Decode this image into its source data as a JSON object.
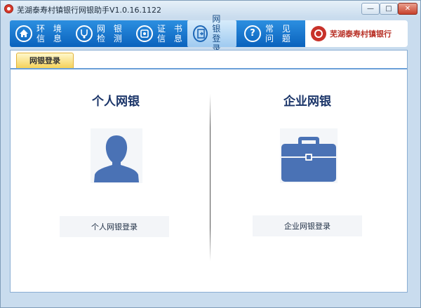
{
  "window": {
    "title": "芜湖泰寿村镇银行网银助手V1.0.16.1122",
    "minimize_glyph": "—",
    "maximize_glyph": "□",
    "close_glyph": "✕"
  },
  "nav": {
    "items": [
      {
        "line1": "环 境",
        "line2": "信 息",
        "icon": "home-icon",
        "active": false
      },
      {
        "line1": "网 银",
        "line2": "检 测",
        "icon": "stethoscope-icon",
        "active": false
      },
      {
        "line1": "证 书",
        "line2": "信 息",
        "icon": "certificate-icon",
        "active": false
      },
      {
        "line1": "网 银",
        "line2": "登 录",
        "icon": "login-icon",
        "active": true
      },
      {
        "line1": "常 见",
        "line2": "问 题",
        "icon": "question-icon",
        "active": false
      }
    ],
    "bank_name": "芜湖泰寿村镇银行"
  },
  "tabs": {
    "active_label": "网银登录"
  },
  "personal": {
    "heading": "个人网银",
    "button_label": "个人网银登录",
    "icon": "person-icon"
  },
  "enterprise": {
    "heading": "企业网银",
    "button_label": "企业网银登录",
    "icon": "briefcase-icon"
  },
  "colors": {
    "nav_blue": "#0a62bd",
    "icon_blue": "#4a72b5",
    "heading_navy": "#1b3569",
    "tab_yellow": "#f5d25a"
  }
}
